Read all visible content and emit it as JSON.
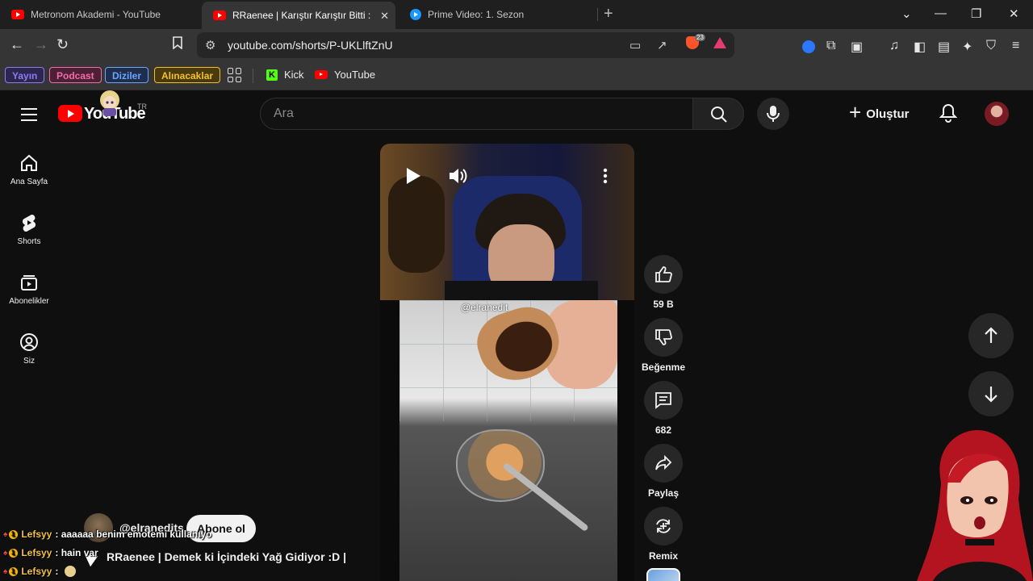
{
  "browser": {
    "tabs": [
      {
        "title": "Metronom Akademi - YouTube",
        "active": false,
        "favicon": "youtube-icon"
      },
      {
        "title": "RRaenee | Karıştır Karıştır Bitti :D",
        "active": true,
        "favicon": "youtube-icon"
      },
      {
        "title": "Prime Video: 1. Sezon",
        "active": false,
        "favicon": "prime-video-icon"
      }
    ],
    "new_tab": "+",
    "url": "youtube.com/shorts/P-UKLlftZnU",
    "brave_shield_count": "23",
    "bookmarks": {
      "chips": [
        {
          "label": "Yayın",
          "color": "#8c7cf0",
          "bg": "#2c2650"
        },
        {
          "label": "Podcast",
          "color": "#f06ca8",
          "bg": "#4e2035"
        },
        {
          "label": "Diziler",
          "color": "#6aa6ff",
          "bg": "#1f2e4d"
        },
        {
          "label": "Alınacaklar",
          "color": "#f2c12e",
          "bg": "#4a3a0c"
        }
      ],
      "links": [
        {
          "label": "Kick",
          "icon": "kick-icon"
        },
        {
          "label": "YouTube",
          "icon": "youtube-icon"
        }
      ]
    }
  },
  "youtube": {
    "logo_text": "YouTube",
    "region": "TR",
    "search_placeholder": "Ara",
    "create_label": "Oluştur",
    "guide": [
      {
        "label": "Ana Sayfa",
        "icon": "home-icon"
      },
      {
        "label": "Shorts",
        "icon": "shorts-icon"
      },
      {
        "label": "Abonelikler",
        "icon": "subscriptions-icon"
      },
      {
        "label": "Siz",
        "icon": "you-icon"
      }
    ],
    "short": {
      "watermark": "@elranedit",
      "channel": "@elranedits",
      "subscribe_label": "Abone ol",
      "title": "RRaenee | Demek ki İçindeki Yağ Gidiyor :D |"
    },
    "actions": {
      "likes": "59 B",
      "dislike_label": "Beğenme",
      "comments": "682",
      "share_label": "Paylaş",
      "remix_label": "Remix"
    }
  },
  "chat": [
    {
      "user": "Lefsyy",
      "message": "aaaaaa benim emotemi kullanıyo"
    },
    {
      "user": "Lefsyy",
      "message": "hain var"
    },
    {
      "user": "Lefsyy",
      "message": ""
    }
  ],
  "colors": {
    "yt_red": "#ff0000",
    "bg": "#0f0f0f",
    "chat_username": "#f5c242"
  }
}
